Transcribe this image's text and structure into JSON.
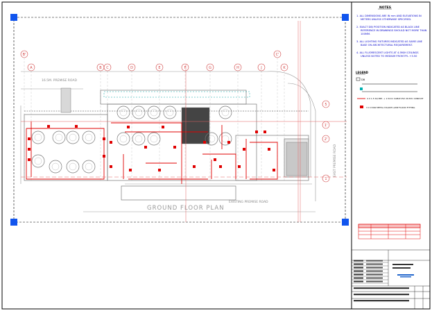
{
  "drawing": {
    "plan_title": "GROUND FLOOR PLAN",
    "road_top": "16.5M. PREMISE ROAD",
    "road_bottom": "EXISTING PREMISE ROAD",
    "road_right": "EAST PREMISE ROAD",
    "grid_columns": [
      "B'",
      "A",
      "B",
      "C",
      "D",
      "E",
      "F",
      "G",
      "H",
      "J",
      "K",
      "C'"
    ],
    "grid_rows": [
      "5",
      "1'",
      "2'",
      "1"
    ]
  },
  "notes": {
    "heading": "NOTES",
    "items": [
      "1. ALL DIMENSIONS ARE IN mm AND ELEVATIONS IN METERS UNLESS OTHERWISE SPECIFIED.",
      "2. EXACT DB/ POSITION INDICATED AS BLACK LINE REFERENCE IN DRAWINGS SHOULD NOT MORE THAN 100MM.",
      "3. ALL LIGHTING FIXTURES INDICATED AS SAME LINE BASE ON ARCHITECTURAL REQUIREMENT.",
      "4. ALL FLUORESCENT LIGHTS AT 4.5M/H CEILINGS UNLESS NOTED TO MEDIUM FROM FFL +3.50"
    ]
  },
  "legend": {
    "heading": "LEGEND",
    "items": [
      "DB",
      "",
      "",
      "4 X 1.5 SQ.MM. + 1.5mm CABLE PVC IN PVC CONDUIT",
      "3 X 150W METAL HALIDE LAMP FLOOD FITTING"
    ]
  },
  "colors": {
    "frame": "#000000",
    "drawing_line": "#9a9a9a",
    "electrical": "#e00000",
    "notes_text": "#0000cc",
    "grid_bubble": "#d04040",
    "corner_marker": "#1155ee",
    "cyan_mark": "#00b0b0"
  }
}
